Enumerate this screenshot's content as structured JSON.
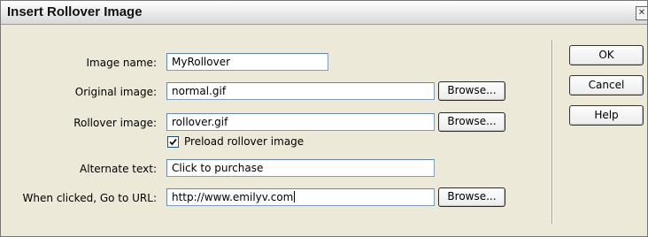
{
  "dialog": {
    "title": "Insert Rollover Image",
    "close_symbol": "✕"
  },
  "form": {
    "image_name": {
      "label": "Image name:",
      "value": "MyRollover"
    },
    "original_image": {
      "label": "Original image:",
      "value": "normal.gif",
      "browse_label": "Browse..."
    },
    "rollover_image": {
      "label": "Rollover image:",
      "value": "rollover.gif",
      "browse_label": "Browse..."
    },
    "preload": {
      "label": "Preload rollover image",
      "checked": true
    },
    "alternate_text": {
      "label": "Alternate text:",
      "value": "Click to purchase"
    },
    "go_to_url": {
      "label": "When clicked, Go to URL:",
      "value": "http://www.emilyv.com",
      "browse_label": "Browse..."
    }
  },
  "buttons": {
    "ok": "OK",
    "cancel": "Cancel",
    "help": "Help"
  },
  "icons": {
    "close": "close-icon",
    "checkmark": "checkmark-icon"
  }
}
